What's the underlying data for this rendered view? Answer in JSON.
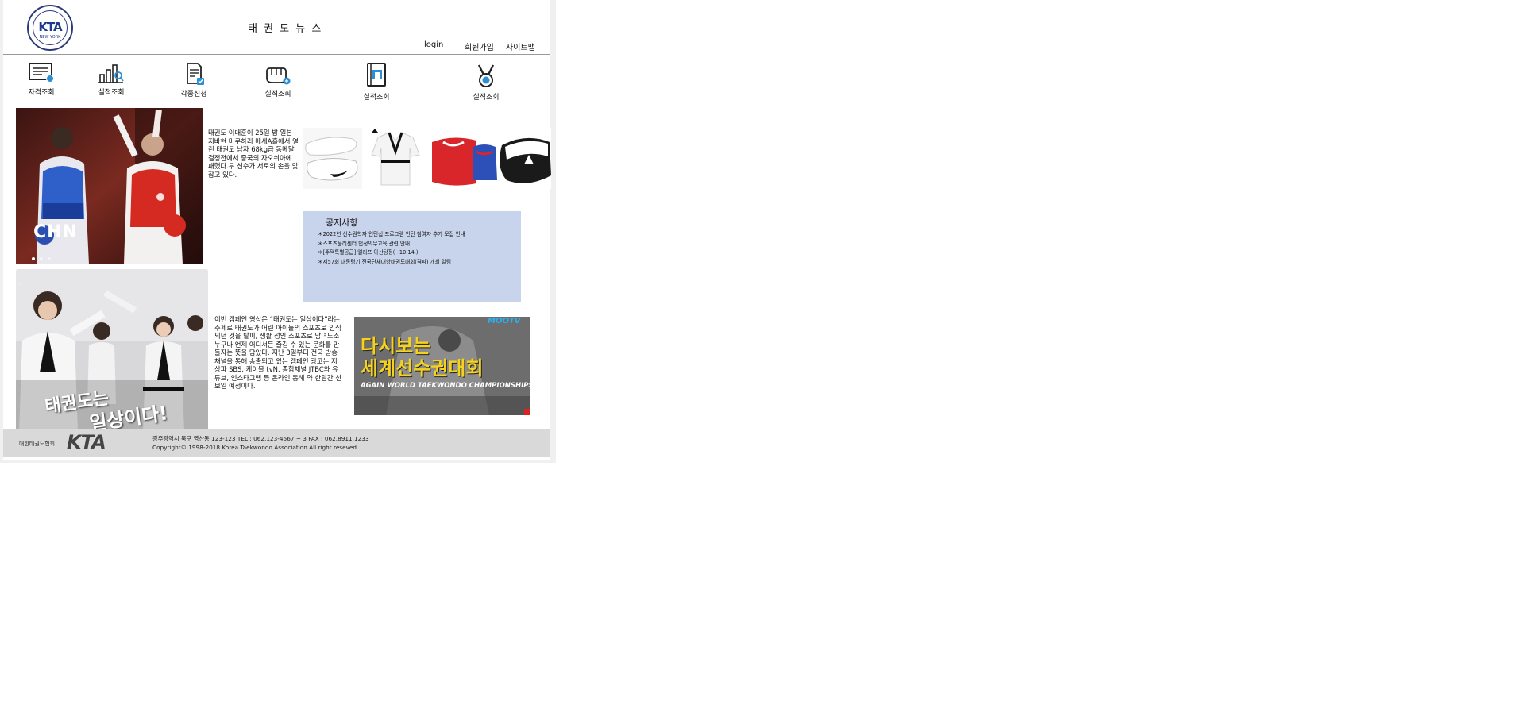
{
  "header": {
    "site_title": "태 권 도 뉴 스",
    "logo_text": "KTA",
    "logo_subtext": "NEW YORK",
    "nav": {
      "login": "login",
      "signup": "회원가입",
      "sitemap": "사이트맵"
    }
  },
  "quick_menu": [
    {
      "label": "자격조회",
      "icon": "certificate-icon"
    },
    {
      "label": "실적조회",
      "icon": "bar-chart-search-icon"
    },
    {
      "label": "각종신청",
      "icon": "document-check-icon"
    },
    {
      "label": "실적조회",
      "icon": "fist-icon"
    },
    {
      "label": "실적조회",
      "icon": "book-icon"
    },
    {
      "label": "실적조회",
      "icon": "medal-icon"
    }
  ],
  "news": {
    "text": "태권도 이대훈이 25일 밤 일본 지바현 마쿠하리 메세A홀에서 열린 태권도 남자 68kg급 동메달 결정전에서 중국의 자오쉬아에 패했다.두 선수가 서로의 손을 맞잡고 있다.",
    "photo_text": "CHN"
  },
  "products": [
    "shoes-image",
    "dobok-image",
    "protector-image",
    "kick-target-image"
  ],
  "notice": {
    "title": "공지사항",
    "items": [
      "＊2022년 선수권학자 인턴십 프로그램 인턴 참여자 추가 모집 안내",
      "＊스포츠윤리센터 법정의무교육 관련 안내",
      "＊[주택특별공급] 엘리프 아산탕정(~10.14.)",
      "＊제57회 대통령기 전국단체대항태권도대회(격파) 개최 알림"
    ]
  },
  "campaign": {
    "text": "이번 캠페인 영상은 “태권도는 일상이다”라는 주제로 태권도가 어린 아이들의 스포츠로 인식되던 것을 탈피, 생활 성인 스포츠로 남녀노소 누구나 언제 어디서든 즐길 수 있는 문화를 만들자는 뜻을 담았다. 지난 3일부터 전국 방송채널을 통해 송출되고 있는 캠페인 광고는 지상파 SBS, 케이블 tvN, 종합채널 JTBC와 유튜브, 인스타그램 등 온라인 통해 약 한달간 선보일 예정이다.",
    "image_caption_line1": "태권도는",
    "image_caption_line2": "일상이다!"
  },
  "video_banner": {
    "badge": "MOOTV",
    "line1": "다시보는",
    "line2": "세계선수권대회",
    "subtitle": "AGAIN WORLD TAEKWONDO CHAMPIONSHIPS"
  },
  "footer": {
    "logo_text": "대한태권도협회",
    "logo_mark": "KTA",
    "address": "광주광역시 북구 영산동 123-123 TEL : 062.123-4567 ~ 3 FAX : 062.8911.1233",
    "copyright": "Copyright© 1998-2018.Korea Taekwondo Association All right reseved."
  },
  "colors": {
    "notice_bg": "#c8d3ec",
    "footer_bg": "#d9d9d9",
    "accent_blue": "#1e3a8a",
    "banner_yellow": "#f5d21d"
  }
}
